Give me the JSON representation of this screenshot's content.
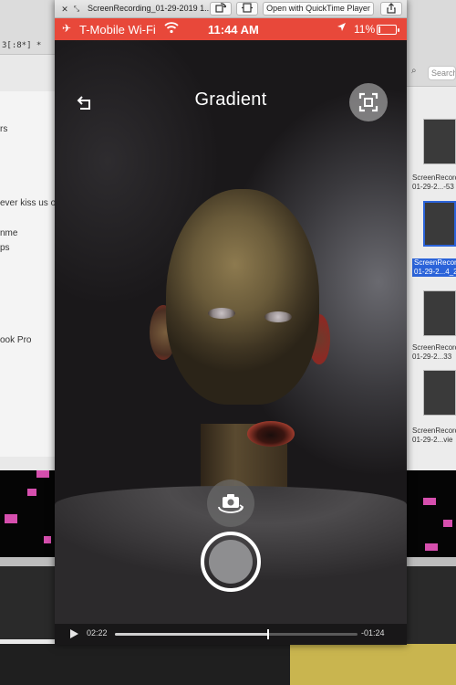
{
  "background_left": {
    "path_text": "3[:8*] *",
    "lines": [
      "rs",
      "ever kiss us on t",
      "nme",
      "ps",
      "ook Pro"
    ]
  },
  "background_right": {
    "search_placeholder": "Search",
    "thumbnails": [
      {
        "label_1": "ScreenRecord",
        "label_2": "01-29-2...-53",
        "selected": false
      },
      {
        "label_1": "ScreenRecord",
        "label_2": "01-29-2...4_2",
        "selected": true
      },
      {
        "label_1": "ScreenRecord",
        "label_2": "01-29-2...33",
        "selected": false
      },
      {
        "label_1": "ScreenRecord",
        "label_2": "01-29-2...vie",
        "selected": false
      }
    ]
  },
  "quicktime": {
    "close_glyph": "✕",
    "min_glyph": "⤡",
    "title": "ScreenRecording_01-29-2019 1...",
    "open_button_label": "Open with QuickTime Player"
  },
  "status_bar": {
    "carrier": "T-Mobile Wi-Fi",
    "time": "11:44 AM",
    "battery_percent_text": "11%",
    "battery_level": 0.11,
    "color": "#e8483a"
  },
  "app": {
    "title": "Gradient"
  },
  "playback": {
    "elapsed": "02:22",
    "remaining": "-01:24",
    "progress": 0.63
  },
  "icons": {
    "back": "back-arrow-icon",
    "capture": "capture-frame-icon",
    "flip": "flip-camera-icon",
    "play": "play-icon",
    "share": "share-icon",
    "rotate": "rotate-icon",
    "trim": "trim-icon"
  }
}
